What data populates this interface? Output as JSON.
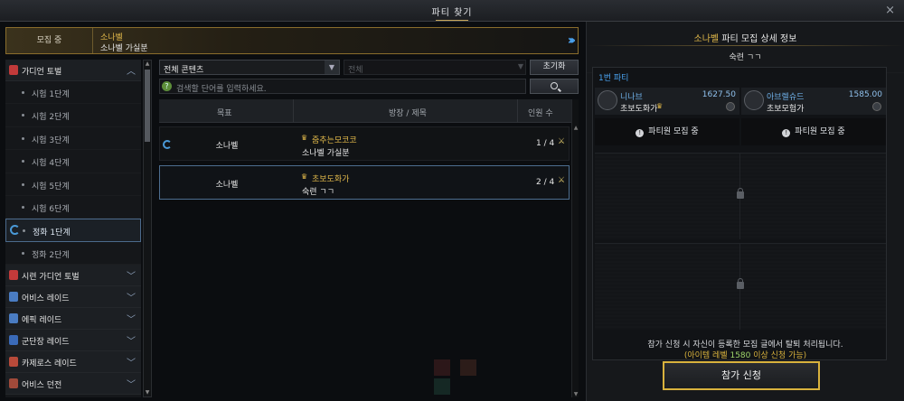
{
  "window": {
    "title": "파티 찾기",
    "close": "×"
  },
  "banner": {
    "label": "모집 중",
    "line1": "소나벨",
    "line2": "소나벨 가실분"
  },
  "sidebar": {
    "categories": [
      {
        "label": "가디언 토벌",
        "icon": "guardian-icon",
        "color": "#c23a3a",
        "chevron": "^"
      },
      {
        "label": "시련 가디언 토벌",
        "icon": "trial-guardian-icon",
        "color": "#c23a3a",
        "chevron": "v"
      },
      {
        "label": "어비스 레이드",
        "icon": "abyss-raid-icon",
        "color": "#4a7cc2",
        "chevron": "v"
      },
      {
        "label": "에픽 레이드",
        "icon": "epic-raid-icon",
        "color": "#4a7cc2",
        "chevron": "v"
      },
      {
        "label": "군단장 레이드",
        "icon": "legion-raid-icon",
        "color": "#3a6ab8",
        "chevron": "v"
      },
      {
        "label": "카제로스 레이드",
        "icon": "kazeros-raid-icon",
        "color": "#b84a3a",
        "chevron": "v"
      },
      {
        "label": "어비스 던전",
        "icon": "abyss-dungeon-icon",
        "color": "#a04a3a",
        "chevron": "v"
      }
    ],
    "subitems": [
      "시험 1단계",
      "시험 2단계",
      "시험 3단계",
      "시험 4단계",
      "시험 5단계",
      "시험 6단계",
      "정화 1단계",
      "정화 2단계"
    ]
  },
  "filters": {
    "content_select": "전체 콘텐츠",
    "sub_select": "전체",
    "reset": "초기화",
    "search_placeholder": "검색할 단어를 입력하세요.",
    "search_help": "?"
  },
  "table": {
    "headers": {
      "goal": "목표",
      "title": "방장 / 제목",
      "count": "인원 수"
    },
    "rows": [
      {
        "goal": "소나벨",
        "leader": "줌추는모코코",
        "title": "소나벨 가실분",
        "count": "1 / 4"
      },
      {
        "goal": "소나벨",
        "leader": "초보도화가",
        "title": "숙련 ㄱㄱ",
        "count": "2 / 4"
      }
    ]
  },
  "detail": {
    "title_highlight": "소나벨",
    "title_rest": " 파티 모집 상세 정보",
    "subtitle": "숙련 ㄱㄱ",
    "party_header": "1번 파티",
    "members": [
      {
        "name": "니나브",
        "class": "초보도화가",
        "level": "1627.50"
      },
      {
        "name": "아브렐슈드",
        "class": "초보모험가",
        "level": "1585.00"
      }
    ],
    "recruiting": "파티원 모집 중",
    "notice_line1": "참가 신청 시 자신이 등록한 모집 글에서 탈퇴 처리됩니다.",
    "notice_pre": "(아이템 레벨 ",
    "notice_level": "1580",
    "notice_post": " 이상 신청 가능)",
    "join_button": "참가 신청"
  }
}
